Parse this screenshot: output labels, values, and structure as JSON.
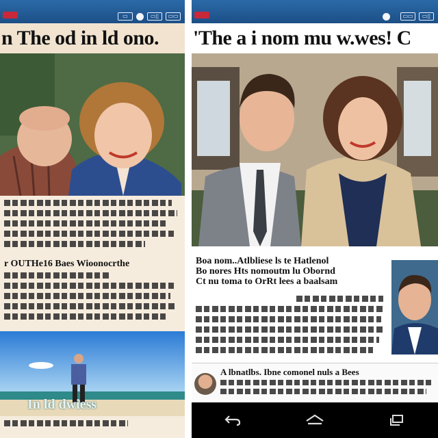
{
  "left_phone": {
    "status_icons": [
      "▭",
      "▭▯",
      "▭▭"
    ],
    "headline": "n The od in ld ono.",
    "subhead": "r OUTHe16 Baes Wioonocrthe",
    "caption": "In ld dwiess"
  },
  "right_phone": {
    "status_icons": [
      "▭▭",
      "▭▯"
    ],
    "headline": "'The a i nom mu w.wes! C",
    "subhead_lines": [
      "Boa nom..Atlbliese ls te Hatlenol",
      "Bo nores Hts nomoutm lu Obornd",
      "Ct nu toma to OrRt lees a baalsam"
    ],
    "reply_text": "A lbnatlbs. Ibne comonel nuls a Bees",
    "nav": {
      "back_icon": "back-arrow",
      "home_icon": "home",
      "recents_icon": "recent-apps"
    }
  },
  "colors": {
    "statusbar": "#2a6aa8",
    "navbar": "#000000",
    "newsprint": "#f6ecdd"
  }
}
